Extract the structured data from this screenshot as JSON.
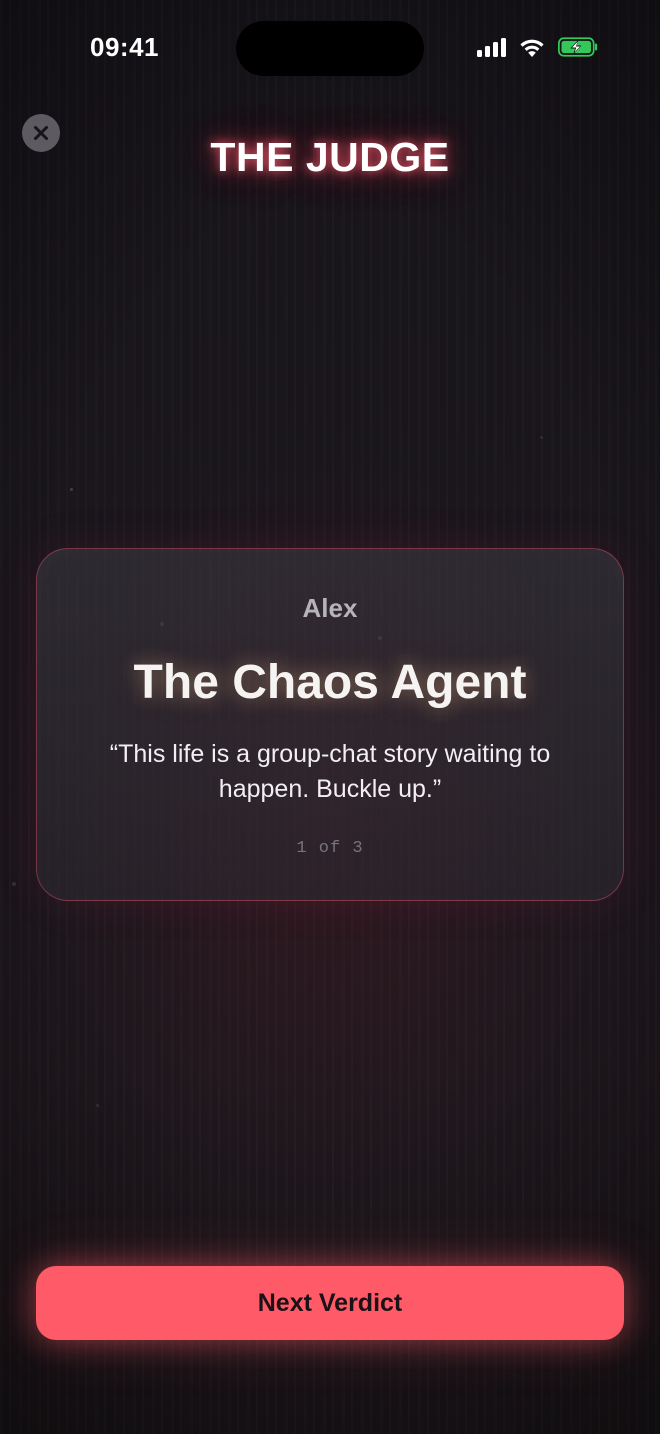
{
  "status_bar": {
    "time": "09:41"
  },
  "header": {
    "close_icon": "close-icon",
    "title": "THE JUDGE"
  },
  "card": {
    "name": "Alex",
    "title": "The Chaos Agent",
    "quote": "“This life is a group-chat story waiting to happen. Buckle up.”",
    "counter": "1 of 3"
  },
  "footer": {
    "next_label": "Next Verdict"
  },
  "colors": {
    "accent": "#fe5a67",
    "background": "#18151b",
    "battery_charging": "#34c759"
  }
}
